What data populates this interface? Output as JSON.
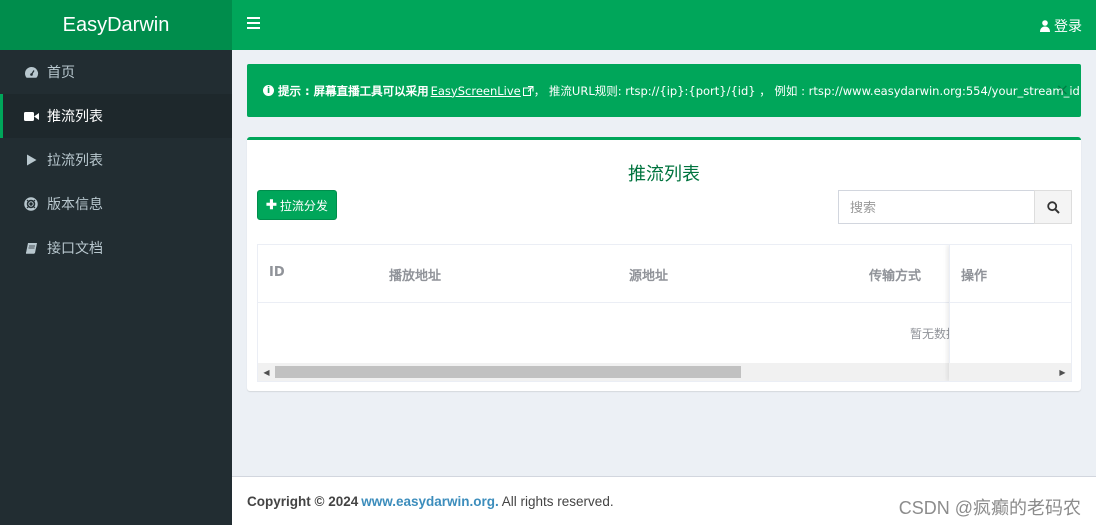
{
  "app": {
    "logo": "EasyDarwin"
  },
  "sidebar": {
    "items": [
      {
        "label": "首页",
        "icon": "dashboard-icon"
      },
      {
        "label": "推流列表",
        "icon": "video-camera-icon",
        "active": true
      },
      {
        "label": "拉流列表",
        "icon": "play-icon"
      },
      {
        "label": "版本信息",
        "icon": "life-ring-icon"
      },
      {
        "label": "接口文档",
        "icon": "book-icon"
      }
    ]
  },
  "header": {
    "login_label": "登录"
  },
  "alert": {
    "prefix": "提示 : 屏幕直播工具可以采用",
    "link": "EasyScreenLive",
    "suffix": "，  推流URL规则: rtsp://{ip}:{port}/{id} ，  例如 : rtsp://www.easydarwin.org:554/your_stream_id",
    "close": "×"
  },
  "box": {
    "title": "推流列表",
    "add_button": "拉流分发",
    "search_placeholder": "搜索"
  },
  "table": {
    "columns": [
      "ID",
      "播放地址",
      "源地址",
      "传输方式",
      "操作"
    ],
    "empty_text": "暂无数据"
  },
  "footer": {
    "copyright": "Copyright © 2024",
    "link": "www.easydarwin.org.",
    "rights": "All rights reserved."
  },
  "watermark": "CSDN @疯癫的老码农",
  "colors": {
    "brand": "#00a65a",
    "brand_dark": "#008d4c",
    "sidebar_bg": "#222d32"
  }
}
